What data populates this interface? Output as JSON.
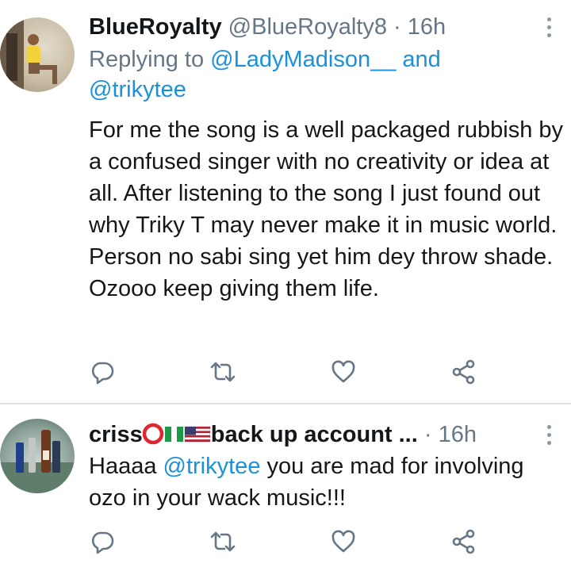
{
  "tweets": [
    {
      "display_name": "BlueRoyalty",
      "handle": "@BlueRoyalty8",
      "separator": "·",
      "time": "16h",
      "replying_prefix": "Replying to",
      "replying_handle_1": "@LadyMadison__",
      "replying_and": "and",
      "replying_handle_2": "@trikytee",
      "text": "For me the song is a well packaged rubbish by a confused singer with no creativity or idea at all. After listening to the song I just found out why Triky T may never make it in music world. Person no sabi sing yet him dey throw shade. Ozooo keep giving them life."
    },
    {
      "display_name_prefix": "criss",
      "display_name_suffix": "back up account ...",
      "separator": "·",
      "time": "16h",
      "text_prefix": "Haaaa",
      "text_mention": "@trikytee",
      "text_suffix": "you are mad for involving ozo in your wack music!!!"
    }
  ],
  "icons": [
    "reply-icon",
    "retweet-icon",
    "like-icon",
    "share-icon",
    "more-icon",
    "red-circle-emoji",
    "nigeria-flag-emoji",
    "usa-flag-emoji"
  ],
  "colors": {
    "mention": "#1a91da",
    "secondary": "#657786",
    "icon": "#657786",
    "divider": "#dfe3e6"
  }
}
